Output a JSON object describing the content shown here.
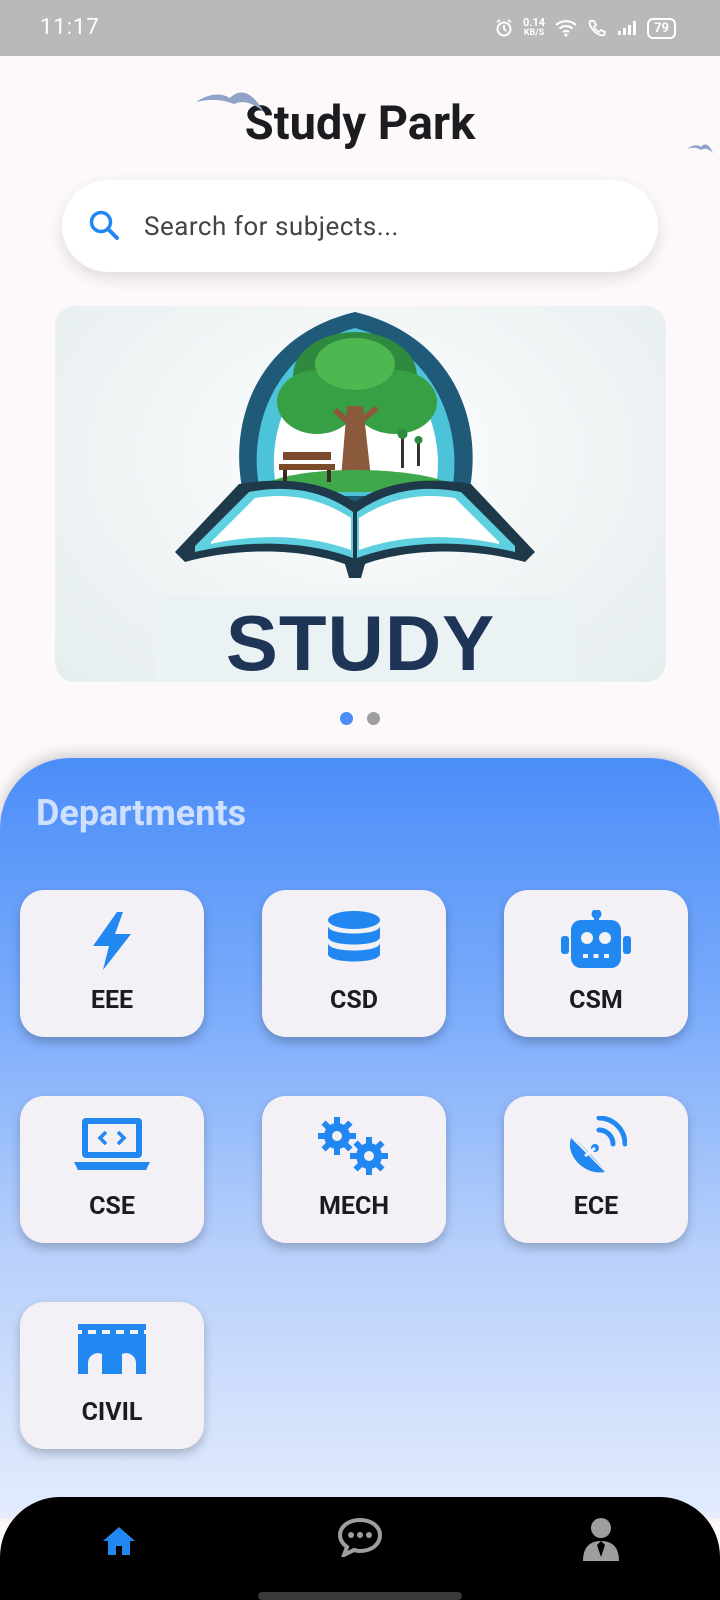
{
  "status_bar": {
    "time": "11:17",
    "net_speed_value": "0.14",
    "net_speed_unit": "KB/S",
    "battery": "79"
  },
  "app": {
    "title": "Study Park"
  },
  "search": {
    "placeholder": "Search for subjects..."
  },
  "banner": {
    "word": "STUDY",
    "page_count": 2,
    "active_page": 1
  },
  "departments": {
    "title": "Departments",
    "items": [
      {
        "label": "EEE",
        "icon": "lightning-bolt-icon"
      },
      {
        "label": "CSD",
        "icon": "database-icon"
      },
      {
        "label": "CSM",
        "icon": "robot-icon"
      },
      {
        "label": "CSE",
        "icon": "laptop-code-icon"
      },
      {
        "label": "MECH",
        "icon": "gears-icon"
      },
      {
        "label": "ECE",
        "icon": "satellite-dish-icon"
      },
      {
        "label": "CIVIL",
        "icon": "bridge-icon"
      }
    ]
  },
  "bottom_nav": {
    "items": [
      {
        "name": "home",
        "icon": "home-icon",
        "active": true
      },
      {
        "name": "chat",
        "icon": "chat-icon",
        "active": false
      },
      {
        "name": "profile",
        "icon": "user-icon",
        "active": false
      }
    ]
  },
  "colors": {
    "accent": "#2188f2",
    "status_bar": "#b9b8ba",
    "departments_gradient_top": "#4b8df9",
    "nav_background": "#000000",
    "nav_inactive": "#9e9e9e"
  }
}
